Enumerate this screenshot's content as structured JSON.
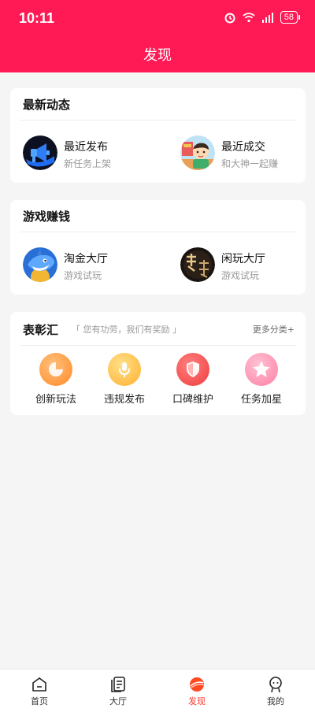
{
  "status": {
    "time": "10:11",
    "battery": "58"
  },
  "header": {
    "title": "发现"
  },
  "latest": {
    "title": "最新动态",
    "items": [
      {
        "title": "最近发布",
        "sub": "新任务上架",
        "icon": "megaphone-icon"
      },
      {
        "title": "最近成交",
        "sub": "和大神一起赚",
        "icon": "cartoon-avatar"
      }
    ]
  },
  "games": {
    "title": "游戏赚钱",
    "items": [
      {
        "title": "淘金大厅",
        "sub": "游戏试玩",
        "icon": "shark-game-icon"
      },
      {
        "title": "闲玩大厅",
        "sub": "游戏试玩",
        "icon": "wulin-game-icon"
      }
    ]
  },
  "honors": {
    "title": "表彰汇",
    "slogan": "「 您有功劳，我们有奖励 」",
    "more": "更多分类+",
    "items": [
      {
        "label": "创新玩法",
        "icon": "pie-chart-icon",
        "color": "#ff9a3c"
      },
      {
        "label": "违规发布",
        "icon": "microphone-icon",
        "color": "#ffc04d"
      },
      {
        "label": "口碑维护",
        "icon": "shield-icon",
        "color": "#ff4d4d"
      },
      {
        "label": "任务加星",
        "icon": "star-icon",
        "color": "#ff8fb0"
      }
    ]
  },
  "tabs": [
    {
      "label": "首页",
      "icon": "home-icon"
    },
    {
      "label": "大厅",
      "icon": "hall-icon"
    },
    {
      "label": "发现",
      "icon": "discover-icon",
      "active": true
    },
    {
      "label": "我的",
      "icon": "profile-icon"
    }
  ]
}
